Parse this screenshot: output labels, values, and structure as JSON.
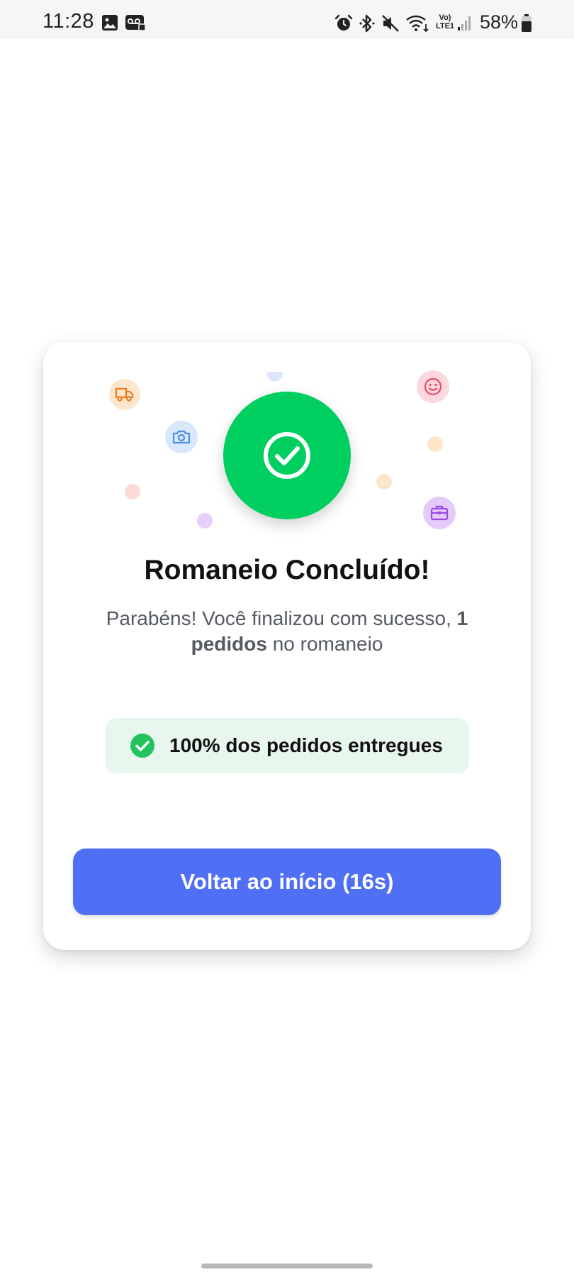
{
  "status_bar": {
    "time": "11:28",
    "battery_percent": "58%",
    "network_label_top": "Vo)",
    "network_label_bottom": "LTE1",
    "icons": [
      "gallery-icon",
      "voicemail-icon",
      "alarm-icon",
      "bluetooth-icon",
      "mute-icon",
      "wifi-icon",
      "signal-icon",
      "battery-icon"
    ]
  },
  "card": {
    "title": "Romaneio Concluído!",
    "subtitle_prefix": "Parabéns! Você finalizou com sucesso, ",
    "subtitle_bold": "1 pedidos",
    "subtitle_suffix": " no romaneio",
    "delivery_badge": "100% dos pedidos entregues",
    "delivered_fraction": 1.0,
    "button_label": "Voltar ao início (16s)",
    "decorative_icons": [
      "truck-icon",
      "camera-icon",
      "smiley-icon",
      "briefcase-icon",
      "check-icon"
    ]
  },
  "colors": {
    "success_green": "#00cf5f",
    "badge_background": "#e8f7ee",
    "primary_button": "#4f6ff4",
    "truck_orange": "#f07a1c",
    "camera_blue": "#4a8fe0",
    "smiley_red": "#f0476a",
    "briefcase_purple": "#9b4be8"
  }
}
